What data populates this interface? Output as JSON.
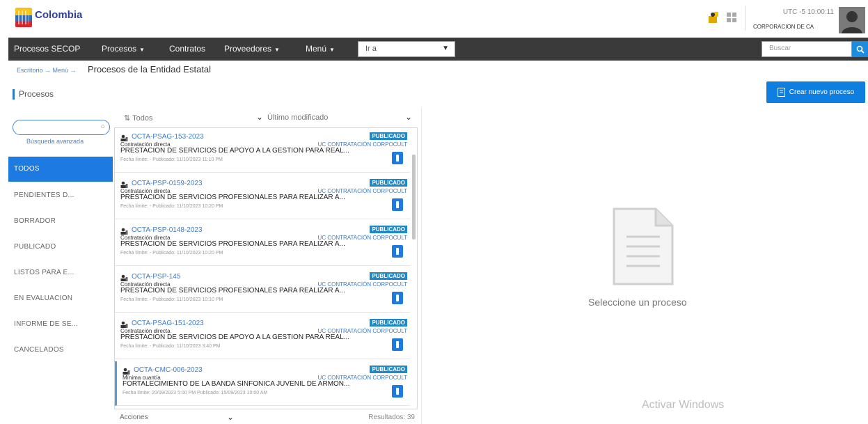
{
  "header": {
    "logo_name": "Colombia",
    "logo_sub": "",
    "link_gold": "",
    "clock": "UTC -5 10:00:11",
    "org": "CORPORACION DE CA"
  },
  "nav": {
    "items": [
      {
        "label": "Procesos SECOP",
        "caret": false
      },
      {
        "label": "Procesos",
        "caret": true
      },
      {
        "label": "Contratos",
        "caret": false
      },
      {
        "label": "Proveedores",
        "caret": true
      },
      {
        "label": "Menú",
        "caret": true
      }
    ],
    "select_value": "Ir a",
    "search_placeholder": "Buscar"
  },
  "breadcrumb": {
    "trail": "Escritorio → Menú →",
    "title": "Procesos de la Entidad Estatal"
  },
  "section_title": "Procesos",
  "create_button": "Crear nuevo proceso",
  "sidebar": {
    "advanced_search": "Búsqueda avanzada",
    "items": [
      {
        "label": "TODOS",
        "active": true
      },
      {
        "label": "PENDIENTES D...",
        "active": false
      },
      {
        "label": "BORRADOR",
        "active": false
      },
      {
        "label": "PUBLICADO",
        "active": false
      },
      {
        "label": "LISTOS PARA E...",
        "active": false
      },
      {
        "label": "EN EVALUACION",
        "active": false
      },
      {
        "label": "INFORME DE SE...",
        "active": false
      },
      {
        "label": "CANCELADOS",
        "active": false
      }
    ]
  },
  "list_header": {
    "sort": "Todos",
    "modified": "Último modificado"
  },
  "cards": [
    {
      "code": "OCTA-PSAG-153-2023",
      "badge": "PUBLICADO",
      "modality": "Contratación directa",
      "entity": "UC CONTRATACIÓN CORPOCULT",
      "desc": "PRESTACION DE SERVICIOS DE APOYO A LA GESTION PARA REAL...",
      "dates": "Fecha límite:  -   Publicado: 11/10/2023 11:10 PM",
      "selected": false
    },
    {
      "code": "OCTA-PSP-0159-2023",
      "badge": "PUBLICADO",
      "modality": "Contratación directa",
      "entity": "UC CONTRATACIÓN CORPOCULT",
      "desc": "PRESTACION DE SERVICIOS PROFESIONALES PARA REALIZAR A...",
      "dates": "Fecha límite:  -   Publicado: 11/10/2023 10:20 PM",
      "selected": false
    },
    {
      "code": "OCTA-PSP-0148-2023",
      "badge": "PUBLICADO",
      "modality": "Contratación directa",
      "entity": "UC CONTRATACIÓN CORPOCULT",
      "desc": "PRESTACION DE SERVICIOS PROFESIONALES PARA REALIZAR A...",
      "dates": "Fecha límite:  -   Publicado: 11/10/2023 10:20 PM",
      "selected": false
    },
    {
      "code": "OCTA-PSP-145",
      "badge": "PUBLICADO",
      "modality": "Contratación directa",
      "entity": "UC CONTRATACIÓN CORPOCULT",
      "desc": "PRESTACION DE SERVICIOS PROFESIONALES PARA REALIZAR A...",
      "dates": "Fecha límite:  -   Publicado: 11/10/2023 10:10 PM",
      "selected": false
    },
    {
      "code": "OCTA-PSAG-151-2023",
      "badge": "PUBLICADO",
      "modality": "Contratación directa",
      "entity": "UC CONTRATACIÓN CORPOCULT",
      "desc": "PRESTACION DE SERVICIOS DE APOYO A LA GESTION PARA REAL...",
      "dates": "Fecha límite:  -   Publicado: 11/10/2023 3:40 PM",
      "selected": false
    },
    {
      "code": "OCTA-CMC-006-2023",
      "badge": "PUBLICADO",
      "modality": "Mínima cuantía",
      "entity": "UC CONTRATACIÓN CORPOCULT",
      "desc": "FORTALECIMIENTO DE LA BANDA SINFONICA JUVENIL DE ARMON...",
      "dates": "Fecha límite: 20/09/2023 5:00 PM   Publicado: 15/09/2023 10:00 AM",
      "selected": true
    }
  ],
  "list_footer": {
    "actions": "Acciones",
    "results": "Resultados: 39"
  },
  "empty_panel": {
    "text": "Seleccione un proceso"
  },
  "watermark": "Activar Windows",
  "colors": {
    "accent": "#1d7ae0",
    "nav_bg": "#3a3a3a",
    "badge": "#1e88c8"
  }
}
